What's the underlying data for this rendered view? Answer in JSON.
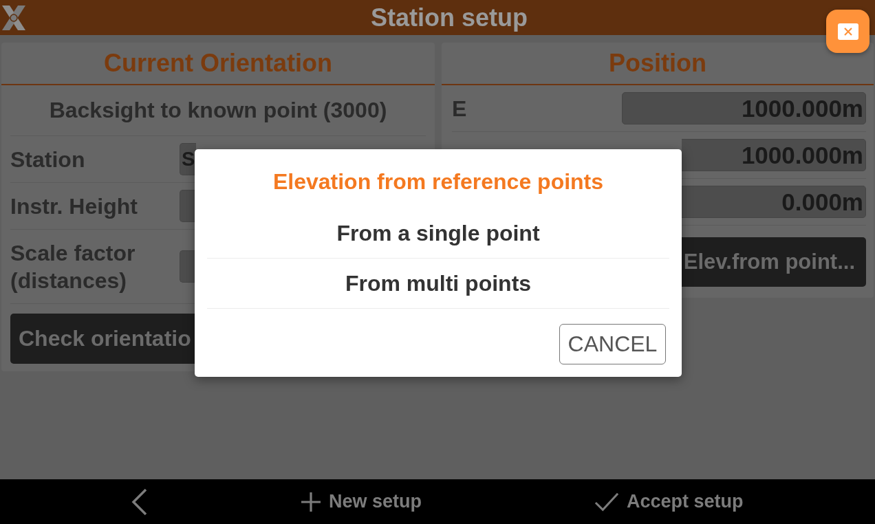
{
  "app_bar": {
    "title": "Station setup"
  },
  "orientation_panel": {
    "title": "Current Orientation",
    "subtitle": "Backsight to known point (3000)",
    "rows": [
      {
        "label": "Station",
        "value": "S"
      },
      {
        "label": "Instr. Height"
      },
      {
        "label": "Scale factor (distances)"
      }
    ],
    "button": "Check orientatio"
  },
  "position_panel": {
    "title": "Position",
    "rows": [
      {
        "label": "E",
        "value": "1000.000m"
      },
      {
        "value": "1000.000m"
      },
      {
        "value": "0.000m"
      }
    ],
    "button": "Elev.from point..."
  },
  "dialog": {
    "title": "Elevation from reference points",
    "options": [
      "From a single point",
      "From multi points"
    ],
    "cancel": "CANCEL"
  },
  "bottom_bar": {
    "actions": [
      {
        "kind": "back"
      },
      {
        "kind": "new",
        "label": "New setup"
      },
      {
        "kind": "accept",
        "label": "Accept setup"
      }
    ]
  }
}
